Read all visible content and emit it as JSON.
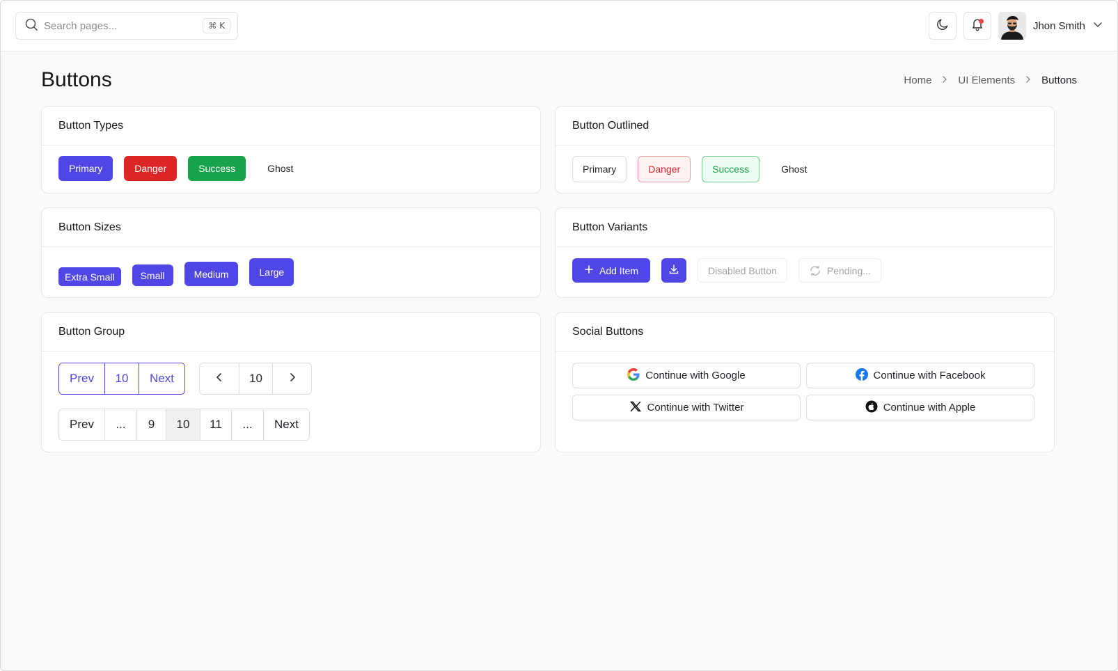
{
  "header": {
    "search_placeholder": "Search pages...",
    "shortcut": "⌘ K",
    "user_name": "Jhon Smith"
  },
  "page": {
    "title": "Buttons",
    "breadcrumb": [
      "Home",
      "UI Elements",
      "Buttons"
    ]
  },
  "cards": {
    "types": {
      "title": "Button Types",
      "buttons": [
        "Primary",
        "Danger",
        "Success",
        "Ghost"
      ]
    },
    "outlined": {
      "title": "Button Outlined",
      "buttons": [
        "Primary",
        "Danger",
        "Success",
        "Ghost"
      ]
    },
    "sizes": {
      "title": "Button Sizes",
      "buttons": [
        "Extra Small",
        "Small",
        "Medium",
        "Large"
      ]
    },
    "variants": {
      "title": "Button Variants",
      "add_item": "Add Item",
      "disabled": "Disabled Button",
      "pending": "Pending..."
    },
    "group": {
      "title": "Button Group",
      "group1": [
        "Prev",
        "10",
        "Next"
      ],
      "group2_value": "10",
      "pagination": [
        "Prev",
        "...",
        "9",
        "10",
        "11",
        "...",
        "Next"
      ]
    },
    "social": {
      "title": "Social Buttons",
      "google": "Continue with Google",
      "facebook": "Continue with Facebook",
      "twitter": "Continue with Twitter",
      "apple": "Continue with Apple"
    }
  },
  "colors": {
    "primary": "#4f46e5",
    "danger": "#dc2626",
    "success": "#16a34a",
    "notification": "#ef4444"
  },
  "icons": [
    "search-icon",
    "moon-icon",
    "bell-icon",
    "chevron-down-icon",
    "chevron-right-icon",
    "plus-icon",
    "download-icon",
    "spinner-icon",
    "chevron-left-icon",
    "google-icon",
    "facebook-icon",
    "x-twitter-icon",
    "apple-icon"
  ]
}
